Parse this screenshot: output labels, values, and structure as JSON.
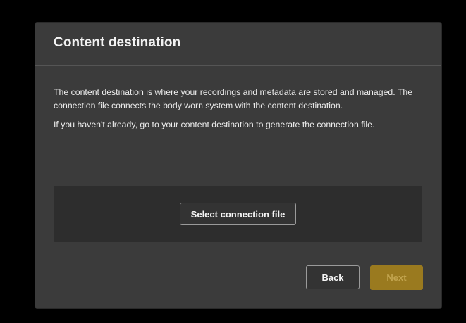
{
  "dialog": {
    "title": "Content destination",
    "paragraph_1": "The content destination is where your recordings and metadata are stored and managed. The connection file connects the body worn system with the content destination.",
    "paragraph_2": "If you haven't already, go to your content destination to generate the connection file.",
    "select_file_label": "Select connection file",
    "back_label": "Back",
    "next_label": "Next",
    "next_enabled": false
  },
  "colors": {
    "background": "#000000",
    "dialog": "#3b3b3b",
    "file_area": "#2d2d2d",
    "accent_disabled": "#9a7a1f"
  }
}
